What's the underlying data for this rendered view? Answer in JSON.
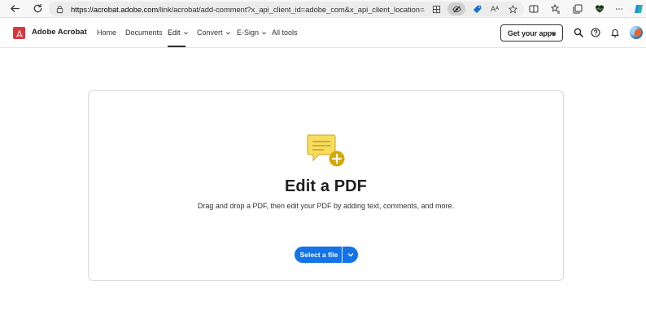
{
  "browser": {
    "url_host": "https://acrobat.adobe.com",
    "url_path": "/link/acrobat/add-comment?x_api_client_id=adobe_com&x_api_client_location=add_comme...",
    "reader_label": "Aᴬ"
  },
  "header": {
    "brand": "Adobe Acrobat",
    "nav": [
      {
        "label": "Home"
      },
      {
        "label": "Documents"
      },
      {
        "label": "Edit"
      },
      {
        "label": "Convert"
      },
      {
        "label": "E-Sign"
      },
      {
        "label": "All tools"
      }
    ],
    "active_nav": "Edit",
    "get_apps_label": "Get your apps"
  },
  "main": {
    "title": "Edit a PDF",
    "subtitle": "Drag and drop a PDF, then edit your PDF by adding text, comments, and more.",
    "select_button_label": "Select a file"
  },
  "colors": {
    "brand_red": "#d7373f",
    "accent_blue": "#1473e6",
    "hero_yellow": "#f6dd5f",
    "hero_plus": "#d4a900"
  },
  "icons": [
    "back-icon",
    "refresh-icon",
    "lock-icon",
    "grid-icon",
    "eye-off-icon",
    "tag-icon",
    "read-aloud-icon",
    "favorite-icon",
    "split-screen-icon",
    "favorites-icon",
    "collections-icon",
    "heart-pulse-icon",
    "copilot-icon",
    "search-icon",
    "help-icon",
    "bell-icon"
  ]
}
